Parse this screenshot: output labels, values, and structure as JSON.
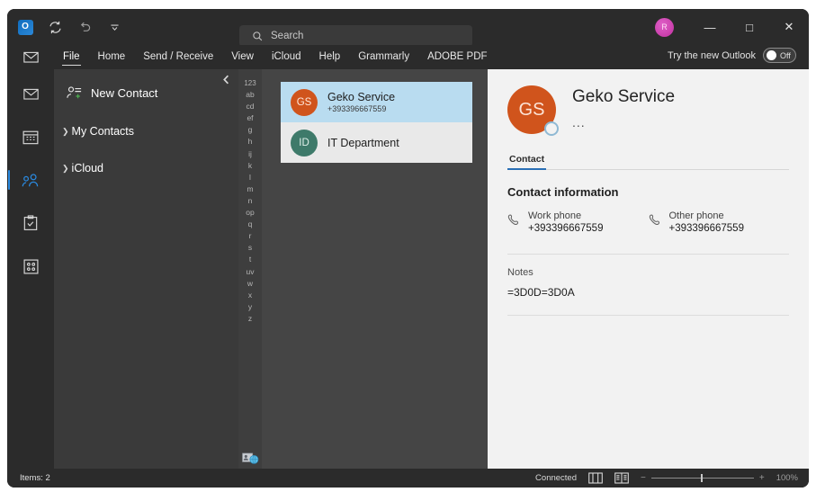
{
  "titlebar": {
    "quick_access": [
      {
        "name": "outlook-logo-icon",
        "label": "O"
      },
      {
        "name": "sync-icon",
        "label": "⟳"
      },
      {
        "name": "undo-icon",
        "label": "↶"
      },
      {
        "name": "customize-qat-icon",
        "label": "▾"
      }
    ],
    "search_placeholder": "Search",
    "search_icon": "search-icon",
    "window_buttons": {
      "minimize": "—",
      "maximize": "□",
      "close": "✕"
    },
    "avatar_initial": "R"
  },
  "ribbon": {
    "mail_icon": "mail-icon",
    "tabs": [
      {
        "label": "File",
        "active": true
      },
      {
        "label": "Home",
        "active": false
      },
      {
        "label": "Send / Receive",
        "active": false
      },
      {
        "label": "View",
        "active": false
      },
      {
        "label": "iCloud",
        "active": false
      },
      {
        "label": "Help",
        "active": false
      },
      {
        "label": "Grammarly",
        "active": false
      },
      {
        "label": "ADOBE PDF",
        "active": false
      }
    ],
    "new_outlook_label": "Try the new Outlook",
    "toggle_state": "Off"
  },
  "navrail": {
    "items": [
      {
        "name": "nav-mail",
        "icon": "mail-icon",
        "selected": false
      },
      {
        "name": "nav-calendar",
        "icon": "calendar-icon",
        "selected": false
      },
      {
        "name": "nav-people",
        "icon": "people-icon",
        "selected": true
      },
      {
        "name": "nav-tasks",
        "icon": "clipboard-check-icon",
        "selected": false
      },
      {
        "name": "nav-more-apps",
        "icon": "apps-grid-icon",
        "selected": false
      }
    ]
  },
  "folderpane": {
    "new_contact_label": "New Contact",
    "new_contact_icon": "person-add-icon",
    "collapse_icon": "chevron-left-icon",
    "groups": [
      {
        "label": "My Contacts",
        "expanded": false
      },
      {
        "label": "iCloud",
        "expanded": false
      }
    ]
  },
  "alpha_index": {
    "letters": [
      "123",
      "ab",
      "cd",
      "ef",
      "g",
      "h",
      "ij",
      "k",
      "l",
      "m",
      "n",
      "op",
      "q",
      "r",
      "s",
      "t",
      "uv",
      "w",
      "x",
      "y",
      "z"
    ],
    "bottom_icon": "contact-card-globe-icon"
  },
  "contact_list": {
    "items": [
      {
        "name": "Geko Service",
        "phone": "+393396667559",
        "initials": "GS",
        "avatar_color": "#d0541c",
        "selected": true
      },
      {
        "name": "IT Department",
        "phone": "",
        "initials": "ID",
        "avatar_color": "#3e7a6a",
        "selected": false
      }
    ]
  },
  "detail": {
    "initials": "GS",
    "avatar_color": "#d0541c",
    "name": "Geko Service",
    "subtitle": "...",
    "tabs": [
      {
        "label": "Contact",
        "active": true
      }
    ],
    "section_title": "Contact information",
    "phones": [
      {
        "label": "Work phone",
        "value": "+393396667559",
        "icon": "phone-icon"
      },
      {
        "label": "Other phone",
        "value": "+393396667559",
        "icon": "phone-icon"
      }
    ],
    "notes_label": "Notes",
    "notes_value": "=3D0D=3D0A"
  },
  "statusbar": {
    "items_label": "Items: 2",
    "connection": "Connected",
    "view_icons": [
      "reading-pane-icon",
      "normal-view-icon"
    ],
    "zoom_minus": "−",
    "zoom_plus": "+",
    "zoom_level": "100%"
  },
  "colors": {
    "accent_blue": "#2a8ae0",
    "selection_blue": "#b9dcf0",
    "avatar_orange": "#d0541c",
    "avatar_teal": "#3e7a6a",
    "tab_underline": "#2a6fb5"
  }
}
